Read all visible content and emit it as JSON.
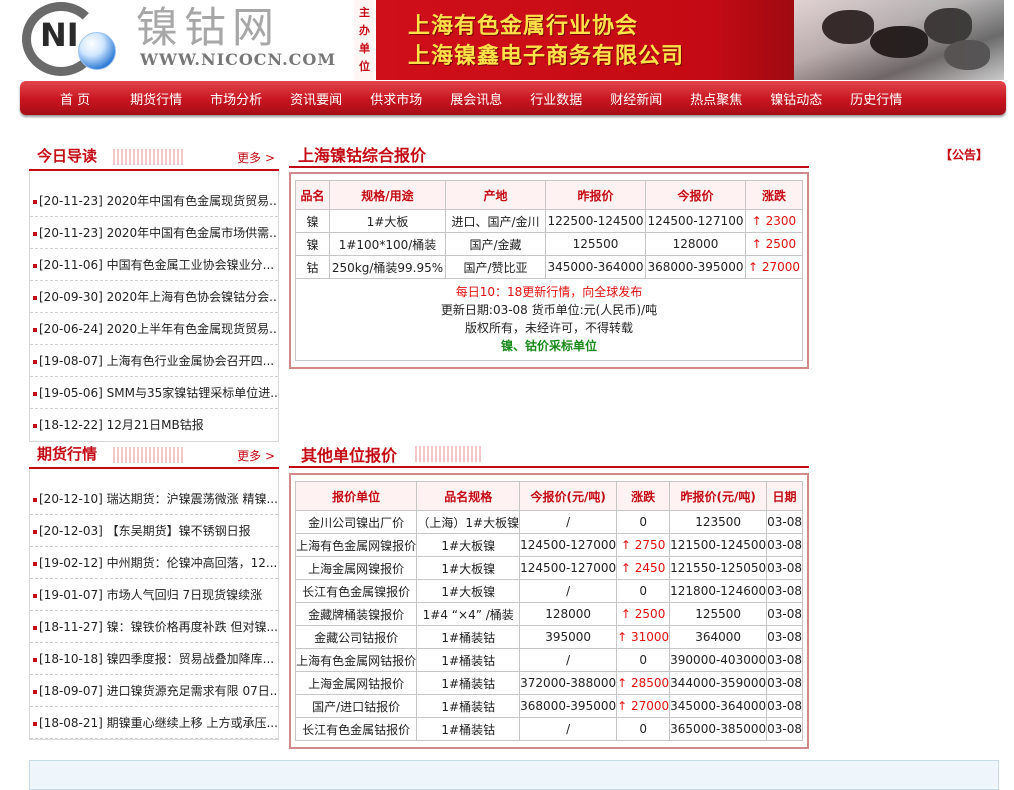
{
  "header": {
    "logo_text": "NI",
    "brand_name": "镍钴网",
    "brand_url": "WWW.NICOCN.COM",
    "host_label": "主办单位",
    "organizer": "上海有色金属行业协会",
    "company": "上海镍鑫电子商务有限公司"
  },
  "nav": {
    "items": [
      "首 页",
      "期货行情",
      "市场分析",
      "资讯要闻",
      "供求市场",
      "展会讯息",
      "行业数据",
      "财经新闻",
      "热点聚焦",
      "镍钴动态",
      "历史行情"
    ]
  },
  "today": {
    "title": "今日导读",
    "more": "更多 >",
    "items": [
      "[20-11-23] 2020年中国有色金属现货贸易...",
      "[20-11-23] 2020年中国有色金属市场供需...",
      "[20-11-06] 中国有色金属工业协会镍业分...",
      "[20-09-30] 2020年上海有色协会镍钴分会...",
      "[20-06-24] 2020上半年有色金属现货贸易...",
      "[19-08-07] 上海有色行业金属协会召开四...",
      "[19-05-06] SMM与35家镍钴锂采标单位进...",
      "[18-12-22] 12月21日MB钴报"
    ]
  },
  "futures": {
    "title": "期货行情",
    "more": "更多 >",
    "items": [
      "[20-12-10] 瑞达期货：沪镍震荡微涨 精镍...",
      "[20-12-03] 【东吴期货】镍不锈钢日报",
      "[19-02-12] 中州期货：伦镍冲高回落，12...",
      "[19-01-07] 市场人气回归 7日现货镍续涨",
      "[18-11-27] 镍：镍铁价格再度补跌 但对镍...",
      "[18-10-18] 镍四季度报：贸易战叠加降库...",
      "[18-09-07] 进口镍货源充足需求有限 07日...",
      "[18-08-21] 期镍重心继续上移 上方或承压..."
    ]
  },
  "quote": {
    "title": "上海镍钴综合报价",
    "notice": "【公告】",
    "headers": [
      "品名",
      "规格/用途",
      "产地",
      "昨报价",
      "今报价",
      "涨跌"
    ],
    "rows": [
      [
        "镍",
        "1#大板",
        "进口、国产/金川",
        "122500-124500",
        "124500-127100",
        "↑ 2300"
      ],
      [
        "镍",
        "1#100*100/桶装",
        "国产/金藏",
        "125500",
        "128000",
        "↑ 2500"
      ],
      [
        "钴",
        "250kg/桶装99.95%",
        "国产/赞比亚",
        "345000-364000",
        "368000-395000",
        "↑ 27000"
      ]
    ],
    "footer": [
      "每日10：18更新行情，向全球发布",
      "更新日期:03-08 货币单位:元(人民币)/吨",
      "版权所有，未经许可，不得转载",
      "镍、钴价采标单位"
    ]
  },
  "others": {
    "title": "其他单位报价",
    "headers": [
      "报价单位",
      "品名规格",
      "今报价(元/吨)",
      "涨跌",
      "昨报价(元/吨)",
      "日期"
    ],
    "rows": [
      [
        "金川公司镍出厂价",
        "（上海）1#大板镍",
        "/",
        "0",
        "123500",
        "03-08"
      ],
      [
        "上海有色金属网镍报价",
        "1#大板镍",
        "124500-127000",
        "↑ 2750",
        "121500-124500",
        "03-08"
      ],
      [
        "上海金属网镍报价",
        "1#大板镍",
        "124500-127000",
        "↑ 2450",
        "121550-125050",
        "03-08"
      ],
      [
        "长江有色金属镍报价",
        "1#大板镍",
        "/",
        "0",
        "121800-124600",
        "03-08"
      ],
      [
        "金藏牌桶装镍报价",
        "1#4 “×4” /桶装",
        "128000",
        "↑ 2500",
        "125500",
        "03-08"
      ],
      [
        "金藏公司钴报价",
        "1#桶装钴",
        "395000",
        "↑ 31000",
        "364000",
        "03-08"
      ],
      [
        "上海有色金属网钴报价",
        "1#桶装钴",
        "/",
        "0",
        "390000-403000",
        "03-08"
      ],
      [
        "上海金属网钴报价",
        "1#桶装钴",
        "372000-388000",
        "↑ 28500",
        "344000-359000",
        "03-08"
      ],
      [
        "国产/进口钴报价",
        "1#桶装钴",
        "368000-395000",
        "↑ 27000",
        "345000-364000",
        "03-08"
      ],
      [
        "长江有色金属钴报价",
        "1#桶装钴",
        "/",
        "0",
        "365000-385000",
        "03-08"
      ]
    ]
  },
  "colors": {
    "brand_red": "#c40a14",
    "up_red": "#e01010",
    "green": "#1a8a1a"
  },
  "icons": {
    "bullet": "square-bullet-icon",
    "logo": "nicocn-logo-icon",
    "hero_art": "horses-image"
  }
}
